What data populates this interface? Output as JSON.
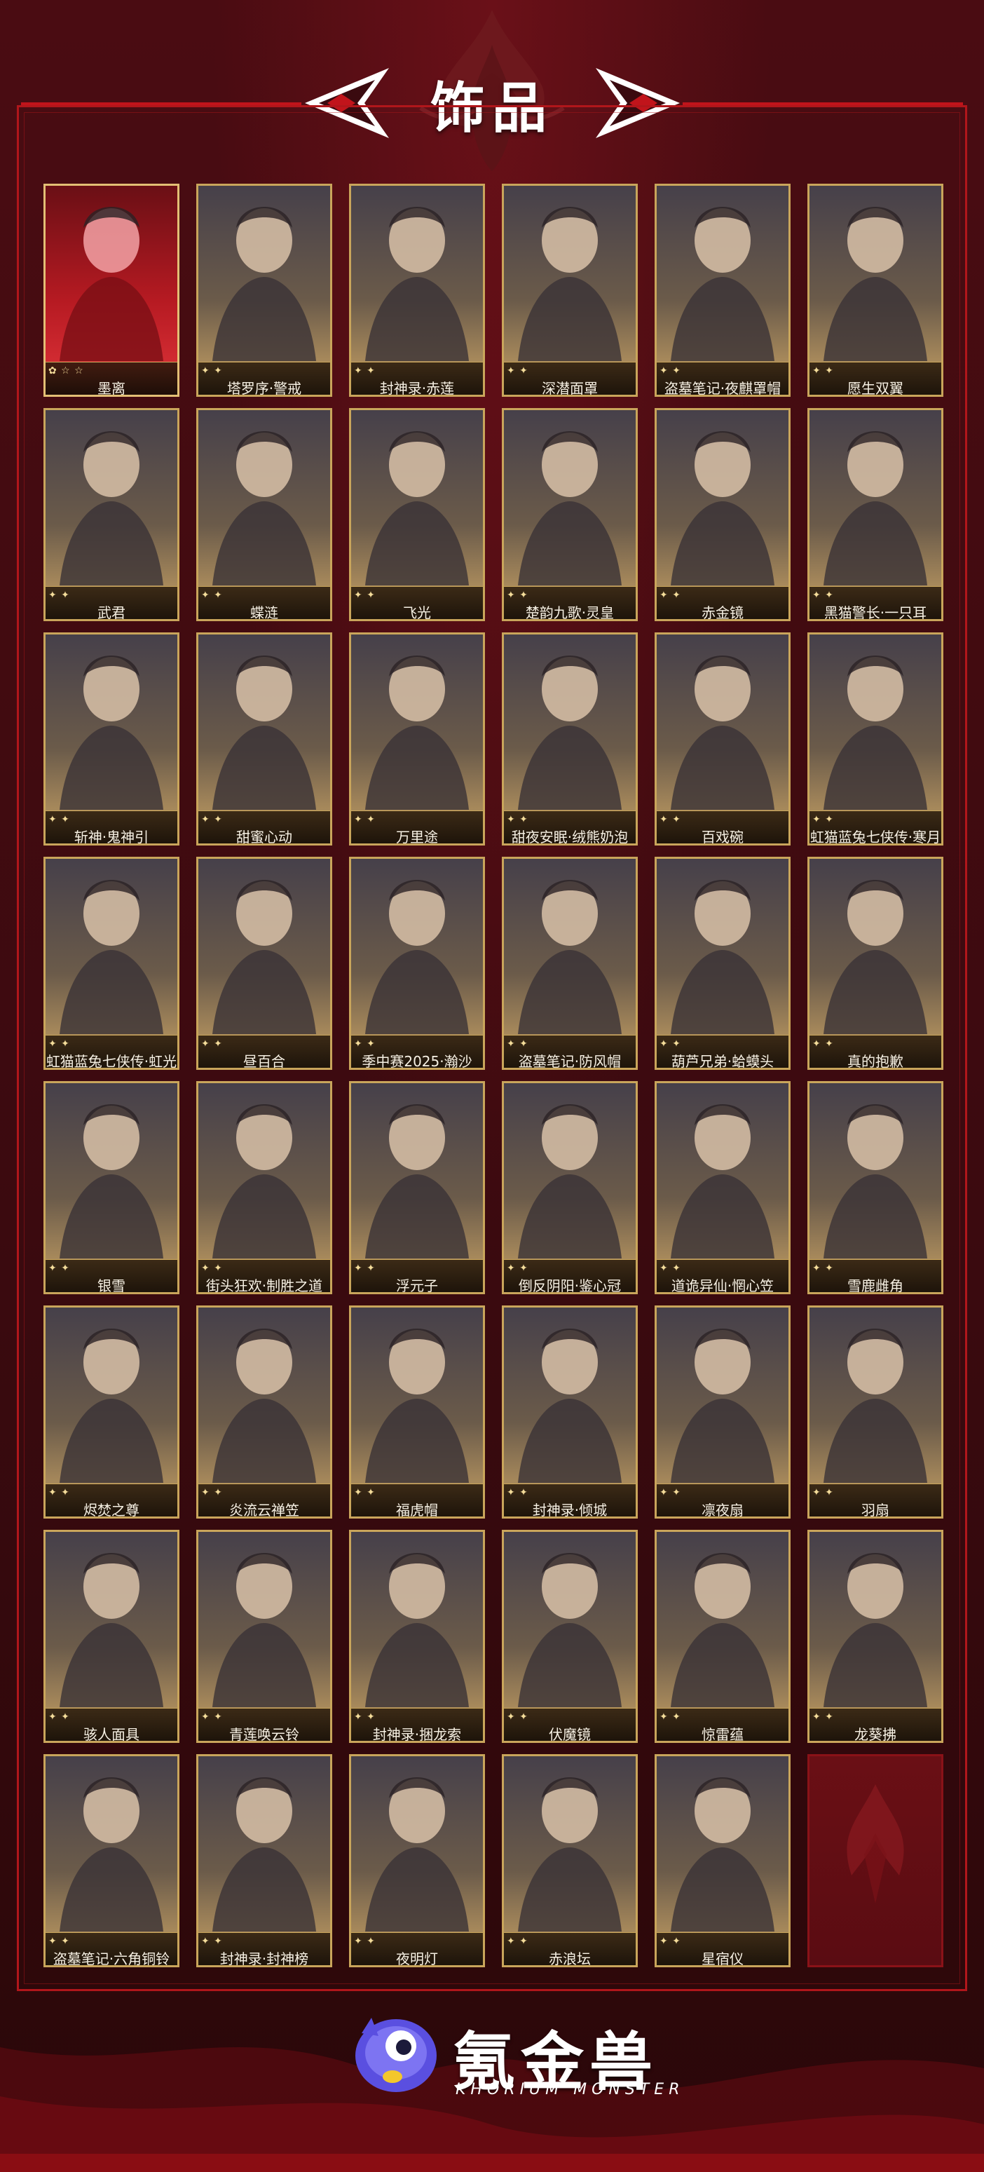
{
  "header": {
    "title": "饰品"
  },
  "colors": {
    "frame_red": "#c1141b",
    "card_gold": "#c9a55b",
    "background": "#3a0a0f"
  },
  "items": [
    {
      "label": "墨离",
      "rank": "✿ ☆ ☆",
      "rare": true
    },
    {
      "label": "塔罗序·警戒",
      "rank": "✦ ✦"
    },
    {
      "label": "封神录·赤莲",
      "rank": "✦ ✦"
    },
    {
      "label": "深潜面罩",
      "rank": "✦ ✦"
    },
    {
      "label": "盗墓笔记·夜麒罩帽",
      "rank": "✦ ✦"
    },
    {
      "label": "愿生双翼",
      "rank": "✦ ✦"
    },
    {
      "label": "武君",
      "rank": "✦ ✦"
    },
    {
      "label": "蝶涟",
      "rank": "✦ ✦"
    },
    {
      "label": "飞光",
      "rank": "✦ ✦"
    },
    {
      "label": "楚韵九歌·灵皇",
      "rank": "✦ ✦"
    },
    {
      "label": "赤金镜",
      "rank": "✦ ✦"
    },
    {
      "label": "黑猫警长·一只耳",
      "rank": "✦ ✦"
    },
    {
      "label": "斩神·鬼神引",
      "rank": "✦ ✦"
    },
    {
      "label": "甜蜜心动",
      "rank": "✦ ✦"
    },
    {
      "label": "万里途",
      "rank": "✦ ✦"
    },
    {
      "label": "甜夜安眠·绒熊奶泡",
      "rank": "✦ ✦"
    },
    {
      "label": "百戏碗",
      "rank": "✦ ✦"
    },
    {
      "label": "虹猫蓝兔七侠传·寒月",
      "rank": "✦ ✦"
    },
    {
      "label": "虹猫蓝兔七侠传·虹光",
      "rank": "✦ ✦"
    },
    {
      "label": "昼百合",
      "rank": "✦ ✦"
    },
    {
      "label": "季中赛2025·瀚沙",
      "rank": "✦ ✦"
    },
    {
      "label": "盗墓笔记·防风帽",
      "rank": "✦ ✦"
    },
    {
      "label": "葫芦兄弟·蛤蟆头",
      "rank": "✦ ✦"
    },
    {
      "label": "真的抱歉",
      "rank": "✦ ✦"
    },
    {
      "label": "银雪",
      "rank": "✦ ✦"
    },
    {
      "label": "街头狂欢·制胜之道",
      "rank": "✦ ✦"
    },
    {
      "label": "浮元子",
      "rank": "✦ ✦"
    },
    {
      "label": "倒反阴阳·鉴心冠",
      "rank": "✦ ✦"
    },
    {
      "label": "道诡异仙·惘心笠",
      "rank": "✦ ✦"
    },
    {
      "label": "雪鹿雌角",
      "rank": "✦ ✦"
    },
    {
      "label": "烬焚之尊",
      "rank": "✦ ✦"
    },
    {
      "label": "炎流云禅笠",
      "rank": "✦ ✦"
    },
    {
      "label": "福虎帽",
      "rank": "✦ ✦"
    },
    {
      "label": "封神录·倾城",
      "rank": "✦ ✦"
    },
    {
      "label": "凛夜扇",
      "rank": "✦ ✦"
    },
    {
      "label": "羽扇",
      "rank": "✦ ✦"
    },
    {
      "label": "骇人面具",
      "rank": "✦ ✦"
    },
    {
      "label": "青莲唤云铃",
      "rank": "✦ ✦"
    },
    {
      "label": "封神录·捆龙索",
      "rank": "✦ ✦"
    },
    {
      "label": "伏魔镜",
      "rank": "✦ ✦"
    },
    {
      "label": "惊雷蕴",
      "rank": "✦ ✦"
    },
    {
      "label": "龙葵拂",
      "rank": "✦ ✦"
    },
    {
      "label": "盗墓笔记·六角铜铃",
      "rank": "✦ ✦"
    },
    {
      "label": "封神录·封神榜",
      "rank": "✦ ✦"
    },
    {
      "label": "夜明灯",
      "rank": "✦ ✦"
    },
    {
      "label": "赤浪坛",
      "rank": "✦ ✦"
    },
    {
      "label": "星宿仪",
      "rank": "✦ ✦"
    }
  ],
  "footer": {
    "logo_text": "氪金兽",
    "logo_sub": "KHORIUM MONSTER"
  }
}
